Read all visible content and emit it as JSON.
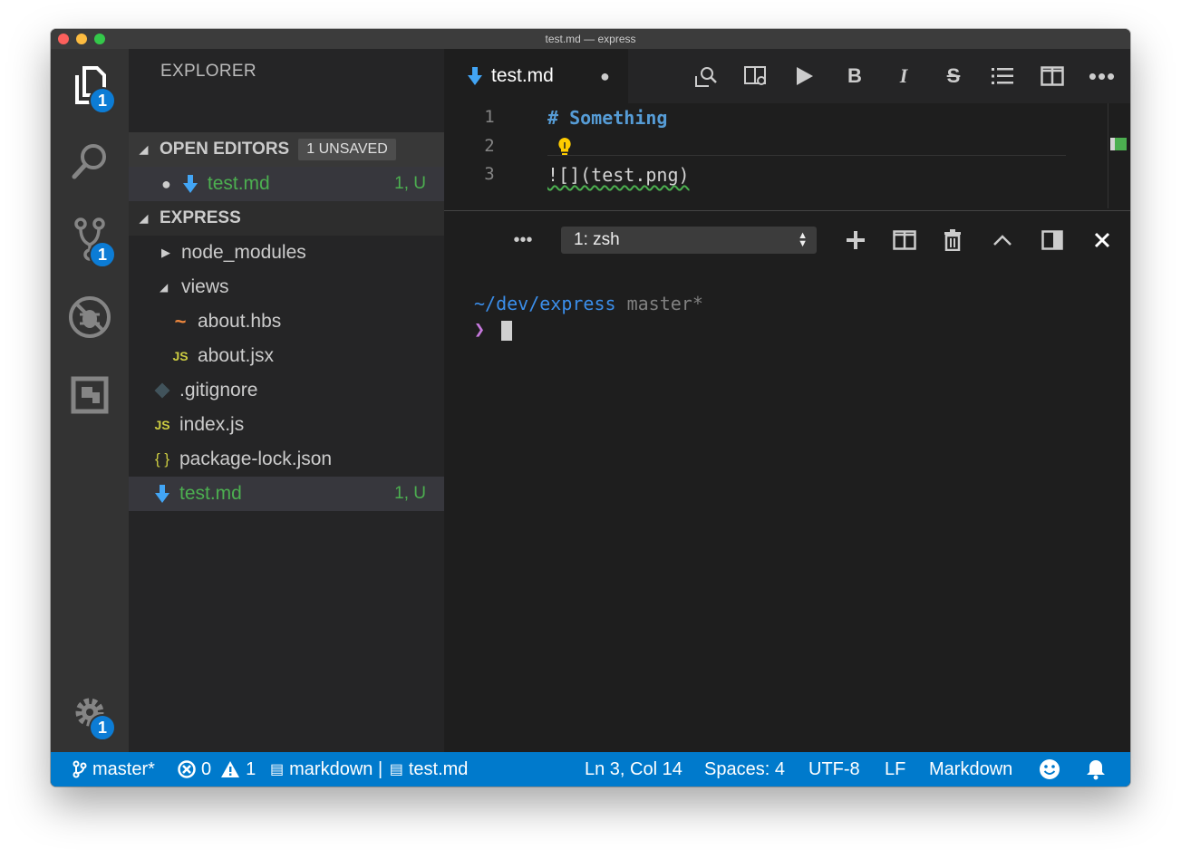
{
  "window": {
    "title": "test.md — express"
  },
  "activity": {
    "explorer_badge": "1",
    "scm_badge": "1",
    "settings_badge": "1"
  },
  "sidebar": {
    "title": "EXPLORER",
    "open_editors": {
      "label": "OPEN EDITORS",
      "badge": "1 UNSAVED",
      "items": [
        {
          "name": "test.md",
          "status": "1, U"
        }
      ]
    },
    "project": {
      "label": "EXPRESS",
      "items": [
        {
          "name": "node_modules"
        },
        {
          "name": "views"
        },
        {
          "name": "about.hbs"
        },
        {
          "name": "about.jsx"
        },
        {
          "name": ".gitignore"
        },
        {
          "name": "index.js"
        },
        {
          "name": "package-lock.json"
        },
        {
          "name": "test.md",
          "status": "1, U"
        }
      ]
    }
  },
  "editor": {
    "tab": {
      "label": "test.md"
    },
    "lines": [
      {
        "num": "1",
        "text": "# Something"
      },
      {
        "num": "2",
        "text": ""
      },
      {
        "num": "3",
        "text": "![](test.png)"
      }
    ]
  },
  "terminal": {
    "selected": "1: zsh",
    "cwd": "~/dev/express",
    "branch": "master*",
    "prompt": "❯"
  },
  "statusbar": {
    "branch": "master*",
    "errors": "0",
    "warnings": "1",
    "outline": "markdown | ",
    "file": "test.md",
    "position": "Ln 3, Col 14",
    "spaces": "Spaces: 4",
    "encoding": "UTF-8",
    "eol": "LF",
    "language": "Markdown"
  },
  "colors": {
    "accent": "#007acc",
    "badge": "#0c7cd5",
    "untracked": "#4caf50",
    "heading": "#569cd6",
    "prompt": "#c678dd"
  }
}
